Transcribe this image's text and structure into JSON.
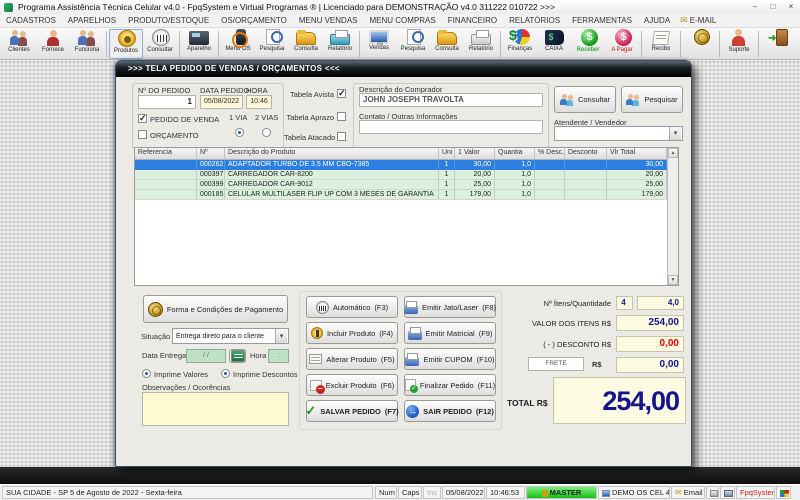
{
  "window": {
    "title": "Programa Assistência Técnica Celular v4.0 - FpqSystem e Virtual Programas ® | Licenciado para  DEMONSTRAÇÃO v4.0 311222 010722 >>>",
    "minimize": "–",
    "maximize": "□",
    "close": "×"
  },
  "menu": {
    "items": [
      "CADASTROS",
      "APARELHOS",
      "PRODUTO/ESTOQUE",
      "OS/ORÇAMENTO",
      "MENU VENDAS",
      "MENU COMPRAS",
      "FINANCEIRO",
      "RELATÓRIOS",
      "FERRAMENTAS",
      "AJUDA"
    ],
    "email_label": "E-MAIL"
  },
  "toolbar": {
    "items": [
      {
        "label": "Clientes"
      },
      {
        "label": "Fornece"
      },
      {
        "label": "Funciona"
      },
      {
        "label": "Produtos"
      },
      {
        "label": "Consultar"
      },
      {
        "label": "Aparelho"
      },
      {
        "label": "Menu OS"
      },
      {
        "label": "Pesquisa"
      },
      {
        "label": "Consulta"
      },
      {
        "label": "Relatório"
      },
      {
        "label": "Vendas"
      },
      {
        "label": "Pesquisa"
      },
      {
        "label": "Consulta"
      },
      {
        "label": "Relatório"
      },
      {
        "label": "Finanças"
      },
      {
        "label": "CAIXA"
      },
      {
        "label": "Receber"
      },
      {
        "label": "A Pagar"
      },
      {
        "label": "Recibo"
      },
      {
        "label": ""
      },
      {
        "label": "Suporte"
      },
      {
        "label": ""
      }
    ]
  },
  "dialog": {
    "title": ">>>   TELA PEDIDO DE VENDAS / ORÇAMENTOS   <<<",
    "order": {
      "num_label": "Nº DO PEDIDO",
      "num": "1",
      "date_label": "DATA PEDIDO",
      "date": "05/08/2022",
      "time_label": "HORA",
      "time": "10:46",
      "sale_label": "PEDIDO DE VENDA",
      "quote_label": "ORÇAMENTO",
      "via1_label": "1 VIA",
      "via2_label": "2 VIAS"
    },
    "tables": {
      "avista": "Tabela Avista",
      "aprazo": "Tabela Aprazo",
      "atacado": "Tabela Atacado"
    },
    "buyer": {
      "desc_label": "Descrição do Comprador",
      "desc_value": "JOHN JOSEPH TRAVOLTA",
      "contact_label": "Contato / Outras Informações",
      "contact_value": "",
      "consult_label": "Consultar",
      "search_label": "Pesquisar",
      "attendant_label": "Atendente / Vendedor",
      "attendant_value": ""
    },
    "grid": {
      "headers": [
        "Referencia",
        "Nº",
        "Descrição do Produto",
        "Uni",
        "1 Valor",
        "Quantia",
        "% Desc.",
        "Desconto",
        "Vlr Total"
      ],
      "rows": [
        {
          "ref": "",
          "num": "000262",
          "desc": "ADAPTADOR TURBO DE 3.5 MM CBO-7385",
          "uni": "1",
          "valor": "30,00",
          "qtd": "1,0",
          "pdesc": "",
          "disc": "",
          "total": "30,00"
        },
        {
          "ref": "",
          "num": "000397",
          "desc": "CARREGADOR CAR-8200",
          "uni": "1",
          "valor": "20,00",
          "qtd": "1,0",
          "pdesc": "",
          "disc": "",
          "total": "20,00"
        },
        {
          "ref": "",
          "num": "000399",
          "desc": "CARREGADOR CAR-9012",
          "uni": "1",
          "valor": "25,00",
          "qtd": "1,0",
          "pdesc": "",
          "disc": "",
          "total": "25,00"
        },
        {
          "ref": "",
          "num": "000185",
          "desc": "CELULAR MULTILASER FLIP UP COM 3 MESES DE GARANTIA",
          "uni": "1",
          "valor": "179,00",
          "qtd": "1,0",
          "pdesc": "",
          "disc": "",
          "total": "179,00"
        }
      ]
    },
    "payment_button": "Forma e Condições de Pagamento",
    "situation": {
      "label": "Situação",
      "value": "Entrega direto para o cliente"
    },
    "delivery": {
      "date_label": "Data Entrega",
      "date_value": "/ /",
      "time_label": "Hora",
      "time_value": ":"
    },
    "print_values_label": "Imprime Valores",
    "print_discounts_label": "Imprime Descontos",
    "obs_label": "Observações / Ocorências",
    "obs_value": "",
    "actions_col1": [
      {
        "label": "Automático",
        "key": "(F3)"
      },
      {
        "label": "Incluir Produto",
        "key": "(F4)"
      },
      {
        "label": "Alterar Produto",
        "key": "(F5)"
      },
      {
        "label": "Excluir Produto",
        "key": "(F6)"
      },
      {
        "label": "SALVAR PEDIDO",
        "key": "(F7)"
      }
    ],
    "actions_col2": [
      {
        "label": "Emitir Jato/Laser",
        "key": "(F8)"
      },
      {
        "label": "Emitir Matricial",
        "key": "(F9)"
      },
      {
        "label": "Emitir CUPOM",
        "key": "(F10)"
      },
      {
        "label": "Finalizar Pedido",
        "key": "(F11)"
      },
      {
        "label": "SAIR  PEDIDO",
        "key": "(F12)"
      }
    ],
    "totals": {
      "items_label": "Nº Ítens/Quantidade",
      "items_count": "4",
      "items_qty": "4,0",
      "value_label": "VALOR DOS ITENS R$",
      "value": "254,00",
      "discount_label": "( - ) DESCONTO R$",
      "discount": "0,00",
      "freight_label": "FRETE",
      "currency": "R$",
      "freight": "0,00",
      "total_label": "TOTAL R$",
      "total": "254,00"
    }
  },
  "statusbar": {
    "location": "SUA CIDADE - SP  5 de Agosto de 2022 - Sexta-feira",
    "num": "Num",
    "caps": "Caps",
    "ins": "Ins",
    "date": "05/08/2022",
    "time": "10:46:53",
    "master": "MASTER",
    "app": "DEMO OS CEL 4.0",
    "email": "Email",
    "brand": "FpqSystem"
  },
  "colors": {
    "selected_row": "#2c7fe0",
    "master_green": "#2ee02e",
    "discount_red": "#e00000",
    "total_navy": "#14148c",
    "brand_red": "#d02020"
  }
}
